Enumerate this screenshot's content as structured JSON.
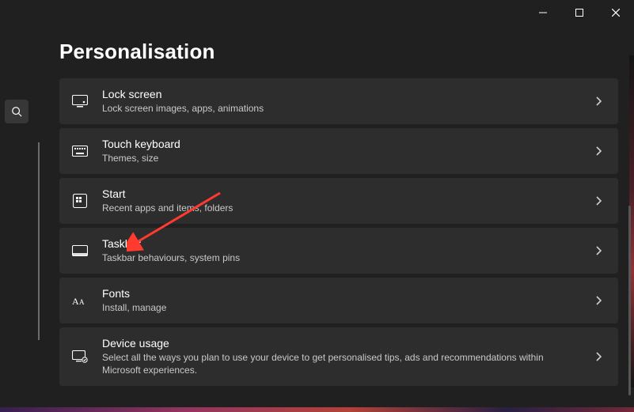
{
  "page": {
    "title": "Personalisation"
  },
  "items": [
    {
      "title": "Lock screen",
      "desc": "Lock screen images, apps, animations"
    },
    {
      "title": "Touch keyboard",
      "desc": "Themes, size"
    },
    {
      "title": "Start",
      "desc": "Recent apps and items, folders"
    },
    {
      "title": "Taskbar",
      "desc": "Taskbar behaviours, system pins"
    },
    {
      "title": "Fonts",
      "desc": "Install, manage"
    },
    {
      "title": "Device usage",
      "desc": "Select all the ways you plan to use your device to get personalised tips, ads and recommendations within Microsoft experiences."
    }
  ]
}
